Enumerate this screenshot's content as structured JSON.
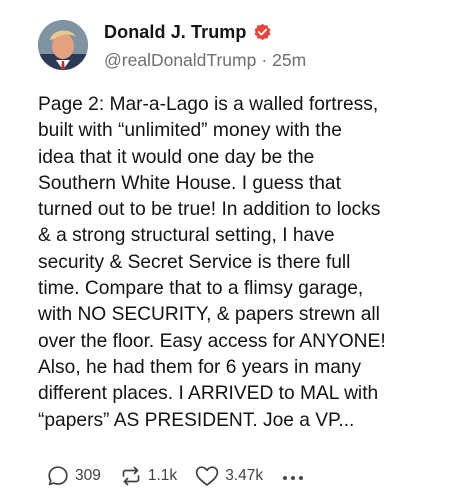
{
  "post": {
    "author": {
      "display_name": "Donald J. Trump",
      "handle": "@realDonaldTrump",
      "verified_badge_color": "#e8453c"
    },
    "time_ago": "25m",
    "separator": "·",
    "body_lines": [
      "Page 2: Mar-a-Lago is a walled fortress,",
      "built with “unlimited” money with the",
      "idea that it would one day be the",
      "Southern White House. I guess that",
      "turned out to be true! In addition to locks",
      "& a strong structural setting, I have",
      "security & Secret Service is there full",
      "time. Compare that to a flimsy garage,",
      "with NO SECURITY, & papers strewn all",
      "over the floor. Easy access for ANYONE!",
      "Also, he had them for 6 years in many",
      "different places. I ARRIVED to MAL with",
      "“papers” AS PRESIDENT. Joe a VP..."
    ],
    "actions": {
      "replies": "309",
      "reposts": "1.1k",
      "likes": "3.47k"
    },
    "icons": {
      "avatar": "profile-photo",
      "verified": "verified-badge-icon",
      "reply": "speech-bubble-icon",
      "repost": "repost-arrows-icon",
      "like": "heart-icon",
      "more": "more-dots-icon"
    }
  }
}
